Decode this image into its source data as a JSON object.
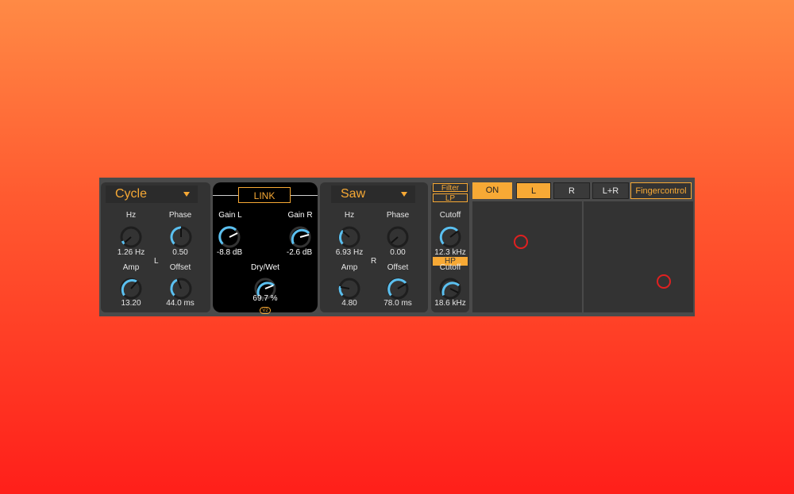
{
  "left_panel": {
    "waveform": "Cycle",
    "channel_label": "L",
    "hz": {
      "label": "Hz",
      "value": "1.26 Hz"
    },
    "phase": {
      "label": "Phase",
      "value": "0.50"
    },
    "amp": {
      "label": "Amp",
      "value": "13.20"
    },
    "offset": {
      "label": "Offset",
      "value": "44.0 ms"
    }
  },
  "link_panel": {
    "link_label": "LINK",
    "gain_l": {
      "label": "Gain L",
      "value": "-8.8 dB"
    },
    "gain_r": {
      "label": "Gain R",
      "value": "-2.6 dB"
    },
    "dry_wet": {
      "label": "Dry/Wet",
      "value": "69.7 %"
    },
    "badge": "V2"
  },
  "right_panel": {
    "waveform": "Saw",
    "channel_label": "R",
    "hz": {
      "label": "Hz",
      "value": "6.93 Hz"
    },
    "phase": {
      "label": "Phase",
      "value": "0.00"
    },
    "amp": {
      "label": "Amp",
      "value": "4.80"
    },
    "offset": {
      "label": "Offset",
      "value": "78.0 ms"
    }
  },
  "filter_panel": {
    "title": "Filter",
    "lp_label": "LP",
    "hp_label": "HP",
    "lp_cutoff": {
      "label": "Cutoff",
      "value": "12.3 kHz"
    },
    "hp_cutoff": {
      "label": "Cutoff",
      "value": "18.6 kHz"
    }
  },
  "toolbar": {
    "on_label": "ON",
    "l_label": "L",
    "r_label": "R",
    "lr_label": "L+R",
    "fingercontrol_label": "Fingercontrol"
  },
  "colors": {
    "accent": "#f7a935",
    "knob_arc": "#5bc0f0",
    "dot": "#e02020"
  }
}
